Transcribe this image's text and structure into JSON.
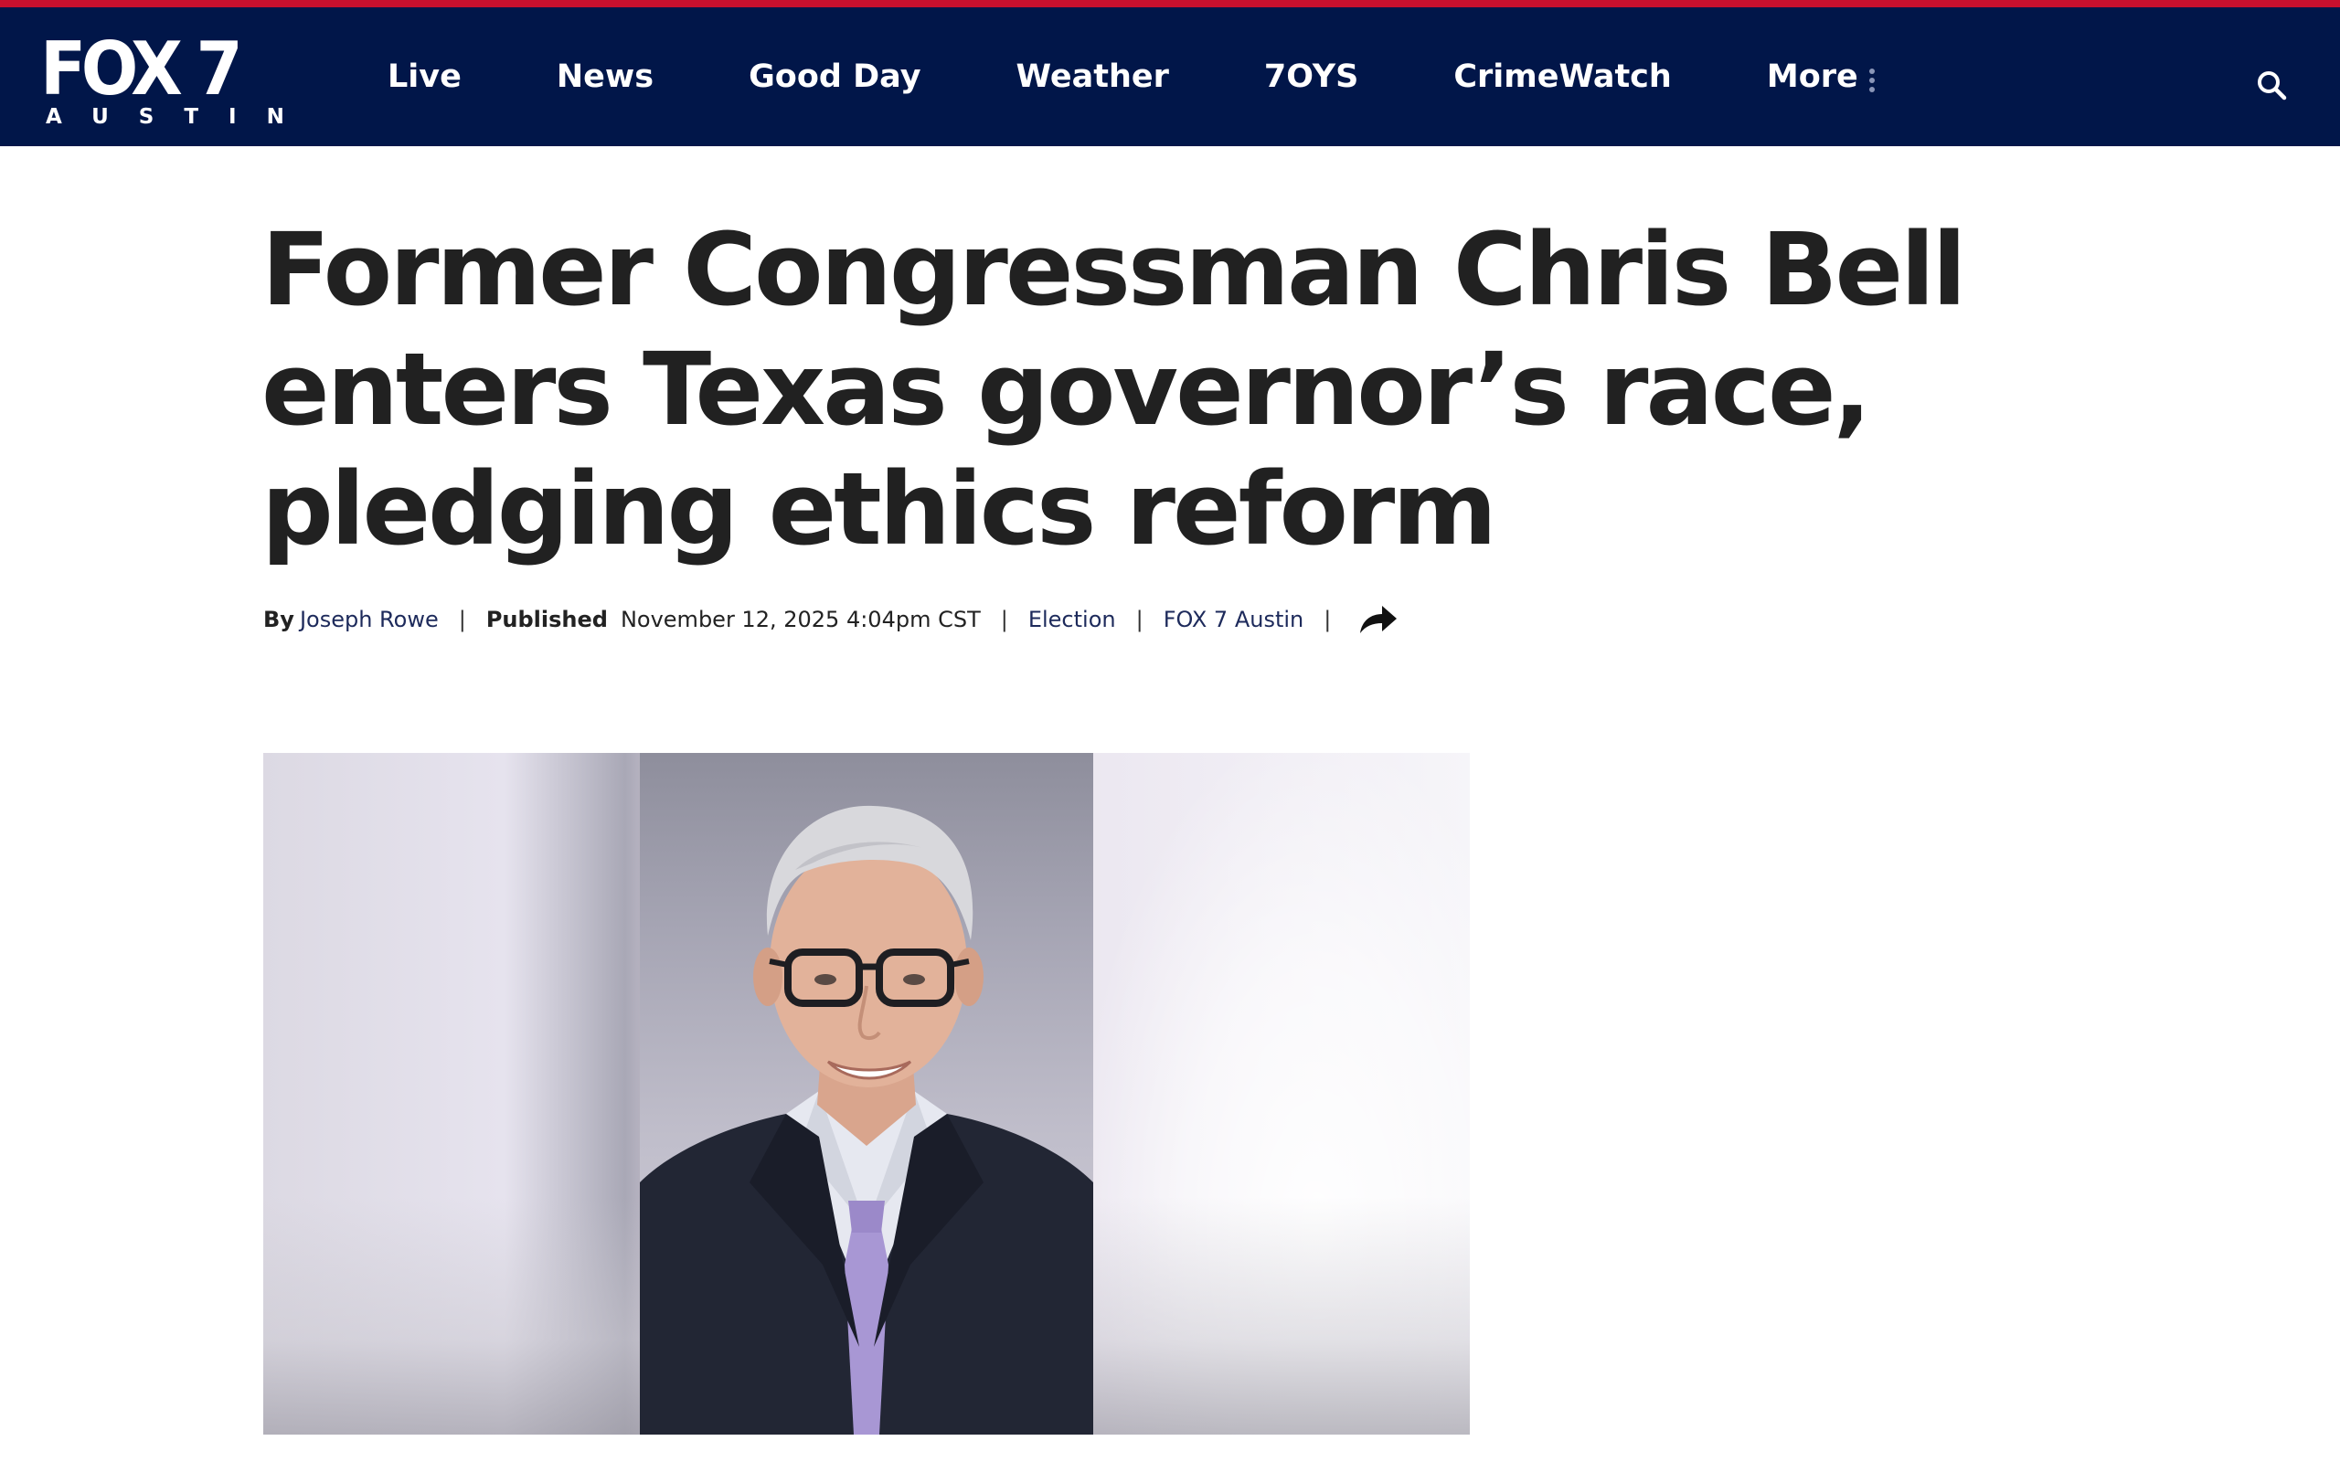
{
  "brand": {
    "logo_main": "FOX 7",
    "logo_sub": "AUSTIN",
    "nav_color": "#011649",
    "accent_color": "#c8102e"
  },
  "nav": {
    "items": [
      {
        "label": "Live"
      },
      {
        "label": "News"
      },
      {
        "label": "Good Day"
      },
      {
        "label": "Weather"
      },
      {
        "label": "7OYS"
      },
      {
        "label": "CrimeWatch"
      },
      {
        "label": "More"
      }
    ],
    "search_icon": "search-icon"
  },
  "article": {
    "headline": "Former Congressman Chris Bell enters Texas governor’s race, pledging ethics reform",
    "by_label": "By",
    "author": "Joseph Rowe",
    "published_label": "Published",
    "published_date": "November 12, 2025 4:04pm CST",
    "category": "Election",
    "source": "FOX 7 Austin",
    "separator": "|",
    "share_icon": "share-arrow-icon"
  }
}
